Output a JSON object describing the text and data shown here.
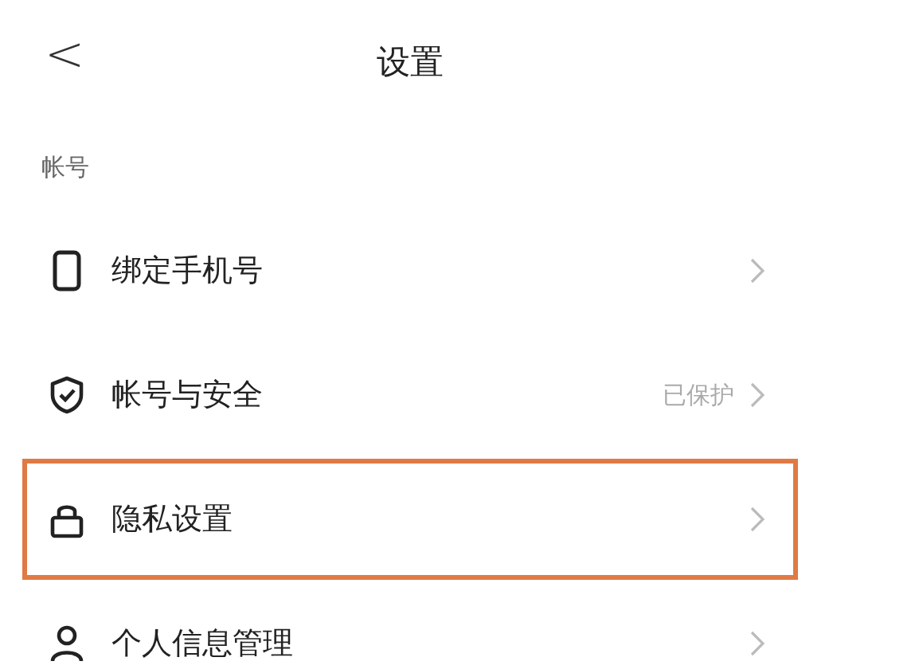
{
  "header": {
    "back": "<",
    "title": "设置"
  },
  "section": {
    "label": "帐号"
  },
  "items": [
    {
      "kind": "phone",
      "label": "绑定手机号",
      "highlighted": false
    },
    {
      "kind": "shield",
      "label": "帐号与安全",
      "value": "已保护",
      "highlighted": false
    },
    {
      "kind": "lock",
      "label": "隐私设置",
      "highlighted": true
    },
    {
      "kind": "person",
      "label": "个人信息管理",
      "highlighted": false
    }
  ]
}
